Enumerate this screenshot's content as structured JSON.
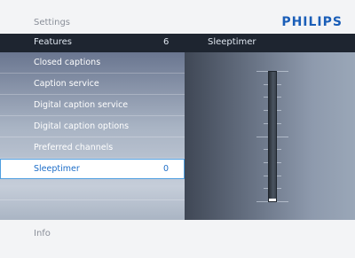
{
  "header": {
    "settings_label": "Settings",
    "brand": "PHILIPS"
  },
  "breadcrumb": {
    "left": "Features",
    "count": "6",
    "right": "Sleeptimer"
  },
  "menu": {
    "items": [
      {
        "label": "Closed captions",
        "value": ""
      },
      {
        "label": "Caption service",
        "value": ""
      },
      {
        "label": "Digital caption service",
        "value": ""
      },
      {
        "label": "Digital caption options",
        "value": ""
      },
      {
        "label": "Preferred channels",
        "value": ""
      },
      {
        "label": "Sleeptimer",
        "value": "0"
      },
      {
        "label": "",
        "value": ""
      },
      {
        "label": "",
        "value": ""
      }
    ],
    "selected_index": 5
  },
  "slider": {
    "value": 0,
    "tick_count": 11
  },
  "footer": {
    "info_label": "Info"
  },
  "colors": {
    "brand": "#1a5eb8",
    "selection": "#1e6ec8",
    "selection_border": "#4f9fe0"
  }
}
